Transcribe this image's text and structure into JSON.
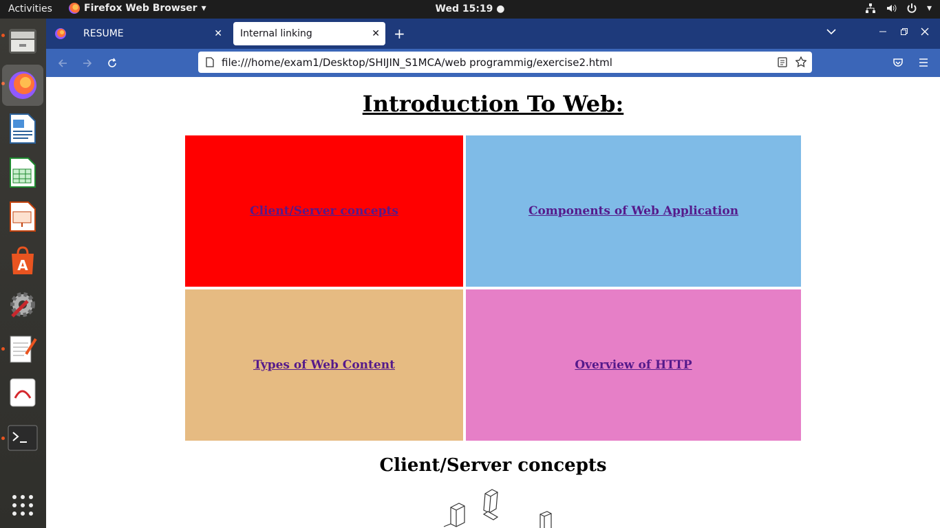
{
  "topbar": {
    "activities": "Activities",
    "app_name": "Firefox Web Browser",
    "clock": "Wed 15:19"
  },
  "dock": {
    "items": [
      "files-icon",
      "firefox-icon",
      "writer-icon",
      "calc-icon",
      "impress-icon",
      "software-icon",
      "settings-icon",
      "text-editor-icon",
      "document-viewer-icon",
      "terminal-icon",
      "show-apps-icon"
    ]
  },
  "browser": {
    "tabs": [
      {
        "label": "RESUME"
      },
      {
        "label": "Internal linking"
      }
    ],
    "url": "file:///home/exam1/Desktop/SHIJIN_S1MCA/web programmig/exercise2.html"
  },
  "page": {
    "heading": "Introduction To Web:",
    "cells": [
      {
        "label": "Client/Server concepts",
        "color": "#ff0000"
      },
      {
        "label": "Components of Web Application",
        "color": "#7fbbe7"
      },
      {
        "label": "Types of Web Content",
        "color": "#e6bb82"
      },
      {
        "label": "Overview of HTTP",
        "color": "#e67fc7"
      }
    ],
    "section_heading": "Client/Server concepts"
  },
  "colors": {
    "link": "#551a8b",
    "tabstrip": "#1e3a7b",
    "navbar": "#3b66b8"
  }
}
